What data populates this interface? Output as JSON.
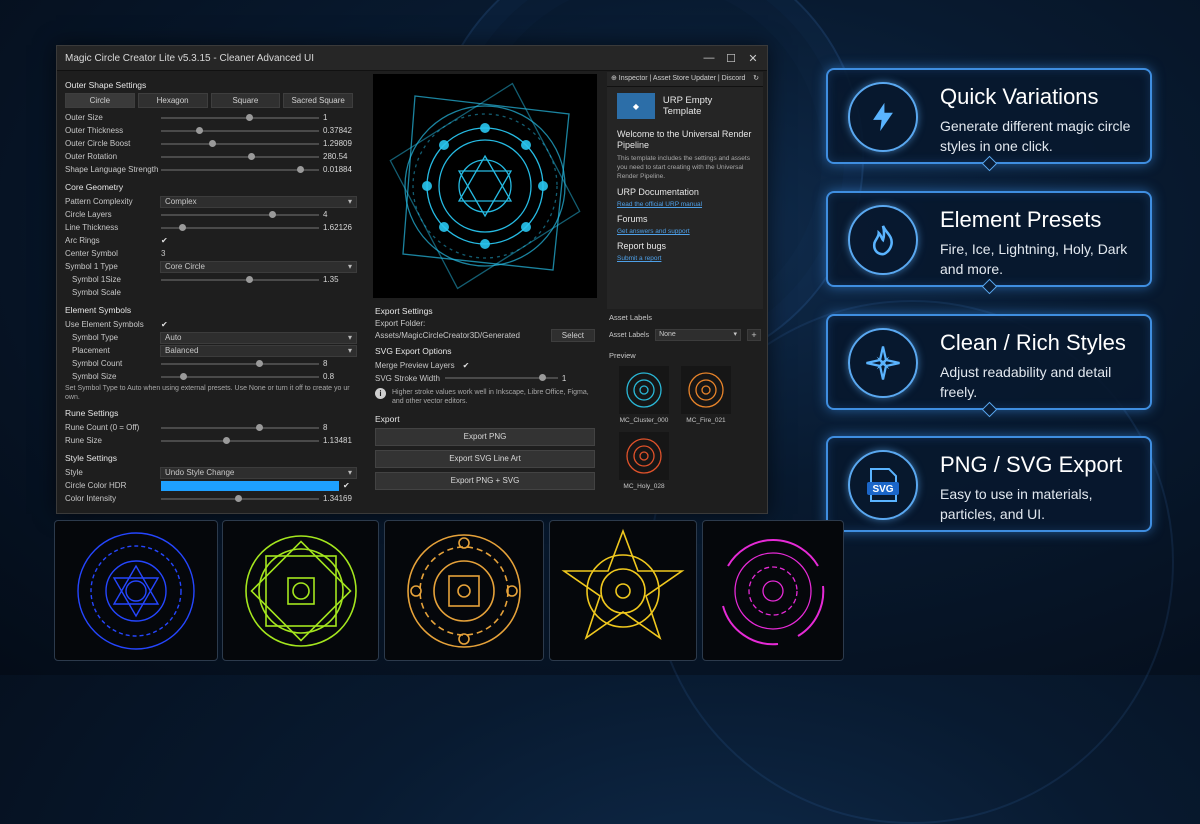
{
  "window": {
    "title": "Magic Circle Creator Lite v5.3.15 - Cleaner Advanced UI",
    "minimize": "—",
    "maximize": "☐",
    "close": "✕"
  },
  "outer_shape": {
    "heading": "Outer Shape Settings",
    "tabs": [
      "Circle",
      "Hexagon",
      "Square",
      "Sacred Square"
    ],
    "rows": [
      {
        "label": "Outer Size",
        "value": "1",
        "level": 0.56
      },
      {
        "label": "Outer Thickness",
        "value": "0.37842",
        "level": 0.24
      },
      {
        "label": "Outer Circle Boost",
        "value": "1.29809",
        "level": 0.32
      },
      {
        "label": "Outer Rotation",
        "value": "280.54",
        "level": 0.57
      },
      {
        "label": "Shape Language Strength",
        "value": "0.01884",
        "level": 0.88
      }
    ]
  },
  "core_geometry": {
    "heading": "Core Geometry",
    "pattern_label": "Pattern Complexity",
    "pattern_value": "Complex",
    "circle_layers_label": "Circle Layers",
    "circle_layers_value": "4",
    "circle_layers_level": 0.7,
    "line_thickness_label": "Line Thickness",
    "line_thickness_value": "1.62126",
    "line_thickness_level": 0.13,
    "arc_rings_label": "Arc Rings",
    "arc_rings_check": "✔",
    "center_symbol_label": "Center Symbol",
    "center_symbol_value": "3",
    "symbol1_type_label": "Symbol 1 Type",
    "symbol1_type_value": "Core Circle",
    "symbol1_size_label": "Symbol 1Size",
    "symbol1_size_value": "1.35",
    "symbol1_size_level": 0.56,
    "symbol_scale_label": "Symbol Scale"
  },
  "element_symbols": {
    "heading": "Element Symbols",
    "use_label": "Use Element Symbols",
    "use_check": "✔",
    "symbol_type_label": "Symbol Type",
    "symbol_type_value": "Auto",
    "placement_label": "Placement",
    "placement_value": "Balanced",
    "count_label": "Symbol Count",
    "count_value": "8",
    "count_level": 0.62,
    "size_label": "Symbol Size",
    "size_value": "0.8",
    "size_level": 0.14,
    "note": "Set Symbol Type to Auto when using external presets. Use None or turn it off to create yo ur own."
  },
  "rune_settings": {
    "heading": "Rune Settings",
    "count_label": "Rune Count (0 = Off)",
    "count_value": "8",
    "count_level": 0.62,
    "size_label": "Rune Size",
    "size_value": "1.13481",
    "size_level": 0.41
  },
  "style_settings": {
    "heading": "Style Settings",
    "style_label": "Style",
    "style_value": "Undo Style Change",
    "color_label": "Circle Color HDR",
    "color_check": "✔",
    "color_hex": "#1ea0ff",
    "intensity_label": "Color Intensity",
    "intensity_value": "1.34169",
    "intensity_level": 0.49
  },
  "export_settings": {
    "heading": "Export Settings",
    "folder_label": "Export Folder:",
    "folder_path": "Assets/MagicCircleCreator3D/Generated",
    "select_button": "Select",
    "svg_heading": "SVG Export Options",
    "merge_label": "Merge Preview Layers",
    "merge_check": "✔",
    "stroke_label": "SVG Stroke Width",
    "stroke_value": "1",
    "stroke_level": 0.86,
    "info_icon": "i",
    "info_text": "Higher stroke values work well in Inkscape, Libre Office, Figma, and other vector editors.",
    "export_heading": "Export",
    "buttons": [
      "Export PNG",
      "Export SVG Line Art",
      "Export PNG + SVG"
    ]
  },
  "inspector": {
    "tabs": "⊕ Inspector | Asset Store Updater | Discord",
    "refresh_icon": "↻",
    "template_title": "URP Empty Template",
    "welcome": "Welcome to the Universal Render Pipeline",
    "intro": "This template includes the settings and assets you need to start creating with the Universal Render Pipeline.",
    "doc_heading": "URP Documentation",
    "doc_link": "Read the official URP manual",
    "forums_heading": "Forums",
    "forums_link": "Get answers and support",
    "bugs_heading": "Report bugs",
    "bugs_link": "Submit a report",
    "asset_labels_heading": "Asset Labels",
    "asset_labels_label": "Asset Labels",
    "asset_labels_value": "None",
    "plus": "+",
    "preview_heading": "Preview",
    "previews": [
      {
        "name": "MC_Cluster_000",
        "color": "#2ab7d6"
      },
      {
        "name": "MC_Fire_021",
        "color": "#e8842a"
      },
      {
        "name": "MC_Holy_028",
        "color": "#e0522a"
      }
    ]
  },
  "features": [
    {
      "title": "Quick Variations",
      "desc": "Generate different magic circle styles in one click.",
      "icon": "lightning-icon"
    },
    {
      "title": "Element Presets",
      "desc": "Fire, Ice, Lightning, Holy, Dark and more.",
      "icon": "flame-icon"
    },
    {
      "title": "Clean / Rich Styles",
      "desc": "Adjust readability and detail freely.",
      "icon": "compass-star-icon"
    },
    {
      "title": "PNG / SVG Export",
      "desc": "Easy to use in materials, particles, and UI.",
      "icon": "svg-file-icon",
      "icon_text": "SVG"
    }
  ],
  "showcase_colors": [
    "#2546ff",
    "#a4e61e",
    "#e6a23a",
    "#f0c81e",
    "#e62ad6"
  ],
  "preview_color": "#29c6f0"
}
